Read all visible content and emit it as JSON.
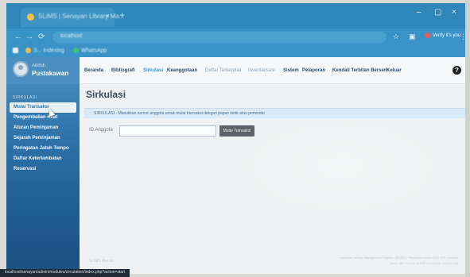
{
  "browser": {
    "tab_title": "SLiMS | Senayan Library Ma...",
    "tab_close": "×",
    "new_tab": "+",
    "win_min": "–",
    "win_max": "▢",
    "win_close": "×",
    "nav_back": "←",
    "nav_forward": "→",
    "nav_reload": "⟳",
    "url": "localhost",
    "verify_label": "Verify it's you",
    "bookmarks": [
      {
        "label": "",
        "color": "#e8eef2"
      },
      {
        "label": "S... Indexing",
        "color": "#f2c14e"
      },
      {
        "label": "WhatsApp",
        "color": "#3ec46d"
      }
    ],
    "status_url": "localhost/senayan/admin/modules/circulation/index.php?action=start"
  },
  "sidebar": {
    "user_name": "Admin",
    "user_role": "Pustakawan",
    "section_heading": "SIRKULASI",
    "items": [
      {
        "label": "Mulai Transaksi",
        "active": true
      },
      {
        "label": "Pengembalian Kilat",
        "active": false
      },
      {
        "label": "Aturan Peminjaman",
        "active": false
      },
      {
        "label": "Sejarah Peminjaman",
        "active": false
      },
      {
        "label": "Peringatan Jatuh Tempo",
        "active": false
      },
      {
        "label": "Daftar Keterlambatan",
        "active": false
      },
      {
        "label": "Reservasi",
        "active": false
      }
    ]
  },
  "topnav": {
    "items": [
      {
        "label": "Beranda",
        "state": "normal"
      },
      {
        "label": "Bibliografi",
        "state": "normal"
      },
      {
        "label": "Sirkulasi",
        "state": "current"
      },
      {
        "label": "Keanggotaan",
        "state": "normal"
      },
      {
        "label": "Daftar Terkendali",
        "state": "faded"
      },
      {
        "label": "Inventarisasi",
        "state": "faded"
      },
      {
        "label": "Sistem",
        "state": "normal"
      },
      {
        "label": "Pelaporan",
        "state": "normal"
      },
      {
        "label": "Kendali Terbitan Berseri",
        "state": "normal"
      },
      {
        "label": "Keluar",
        "state": "normal"
      }
    ],
    "help": "?"
  },
  "page": {
    "title": "Sirkulasi",
    "info": "SIRKULASI - Masukkan nomor anggota untuk mulai transaksi dengan papan ketik atau pemindai",
    "member_label": "ID Anggota",
    "member_value": "",
    "start_button": "Mulai Transaksi",
    "footer_left": "SLiMS Akasia",
    "footer_right_1": "Senayan Library Management System (SLiMS). Released Under GNU GPL License",
    "footer_right_2": "Made with love by SLiMS Developer Community"
  },
  "colors": {
    "accent": "#3a98d2",
    "sidebar_top": "#4e93c4",
    "sidebar_bottom": "#1b4f80",
    "button": "#5f6268"
  }
}
